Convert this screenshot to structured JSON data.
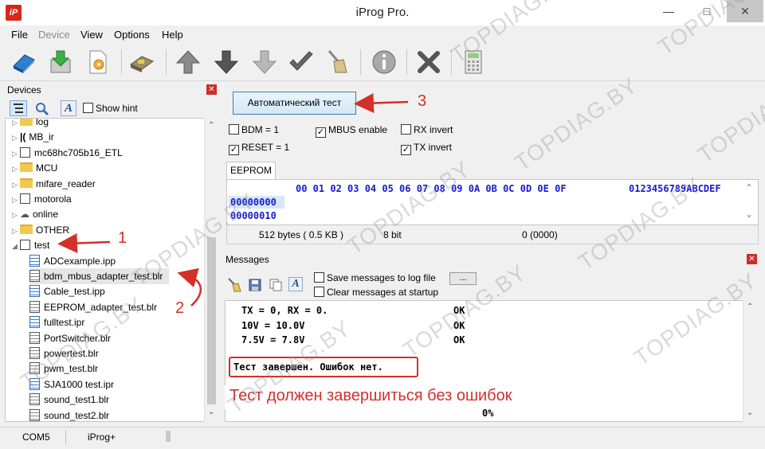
{
  "window": {
    "title": "iProg Pro.",
    "app_icon": "iP"
  },
  "menu": [
    {
      "label": "File",
      "enabled": true
    },
    {
      "label": "Device",
      "enabled": false
    },
    {
      "label": "View",
      "enabled": true
    },
    {
      "label": "Options",
      "enabled": true
    },
    {
      "label": "Help",
      "enabled": true
    }
  ],
  "toolbar_icons": [
    "read-chip-icon",
    "save-download-icon",
    "settings-file-icon",
    "program-device-icon",
    "arrow-up-icon",
    "arrow-down-icon",
    "arrow-down-light-icon",
    "checkmark-icon",
    "broom-icon",
    "info-icon",
    "stop-x-icon",
    "calculator-icon"
  ],
  "devices": {
    "title": "Devices",
    "show_hint_label": "Show hint",
    "tree": [
      {
        "label": "log",
        "type": "folder",
        "level": 0
      },
      {
        "label": "MB_ir",
        "type": "chip-ir",
        "level": 0
      },
      {
        "label": "mc68hc705b16_ETL",
        "type": "chip",
        "level": 0
      },
      {
        "label": "MCU",
        "type": "folder",
        "level": 0
      },
      {
        "label": "mifare_reader",
        "type": "folder",
        "level": 0
      },
      {
        "label": "motorola",
        "type": "chip",
        "level": 0
      },
      {
        "label": "online",
        "type": "cloud",
        "level": 0
      },
      {
        "label": "OTHER",
        "type": "folder",
        "level": 0
      },
      {
        "label": "test",
        "type": "list",
        "level": 0,
        "expanded": true
      },
      {
        "label": "ADCexample.ipp",
        "type": "file-blue",
        "level": 1
      },
      {
        "label": "bdm_mbus_adapter_test.blr",
        "type": "file",
        "level": 1
      },
      {
        "label": "Cable_test.ipp",
        "type": "file-blue",
        "level": 1
      },
      {
        "label": "EEPROM_adapter_test.blr",
        "type": "file",
        "level": 1
      },
      {
        "label": "fulltest.ipr",
        "type": "file-blue",
        "level": 1
      },
      {
        "label": "PortSwitcher.blr",
        "type": "file",
        "level": 1
      },
      {
        "label": "powertest.blr",
        "type": "file",
        "level": 1
      },
      {
        "label": "pwm_test.blr",
        "type": "file",
        "level": 1
      },
      {
        "label": "SJA1000 test.ipr",
        "type": "file-blue",
        "level": 1
      },
      {
        "label": "sound_test1.blr",
        "type": "file",
        "level": 1
      },
      {
        "label": "sound_test2.blr",
        "type": "file",
        "level": 1
      }
    ]
  },
  "auto_test_button": "Автоматический тест",
  "options": [
    {
      "label": "BDM = 1",
      "checked": false
    },
    {
      "label": "MBUS enable",
      "checked": true
    },
    {
      "label": "RX invert",
      "checked": false
    },
    {
      "label": "RESET = 1",
      "checked": true
    },
    {
      "label": "TX invert",
      "checked": true
    }
  ],
  "eeprom": {
    "tab_label": "EEPROM",
    "header": "00 01 02 03 04 05 06 07 08 09 0A 0B 0C 0D 0E 0F",
    "ascii_header": "0123456789ABCDEF",
    "rows": [
      "00000000",
      "00000010"
    ],
    "status": {
      "size": "512 bytes ( 0.5 KB )",
      "bits": "8 bit",
      "address": "0 (0000)"
    }
  },
  "messages": {
    "title": "Messages",
    "save_log_label": "Save messages to log file",
    "clear_startup_label": "Clear messages at startup",
    "browse_label": "...",
    "lines": [
      {
        "text": "TX = 0, RX = 0.",
        "result": "OK"
      },
      {
        "text": "10V = 10.0V",
        "result": "OK"
      },
      {
        "text": "7.5V = 7.8V",
        "result": "OK"
      }
    ],
    "final_line": "Тест завершен. Ошибок нет.",
    "progress": "0%"
  },
  "statusbar": {
    "port": "COM5",
    "device": "iProg+"
  },
  "annotations": {
    "step1": "1",
    "step2": "2",
    "step3": "3",
    "note": "Тест должен завершиться без ошибок",
    "watermark": "TOPDIAG.BY",
    "color": "#d2302b"
  }
}
